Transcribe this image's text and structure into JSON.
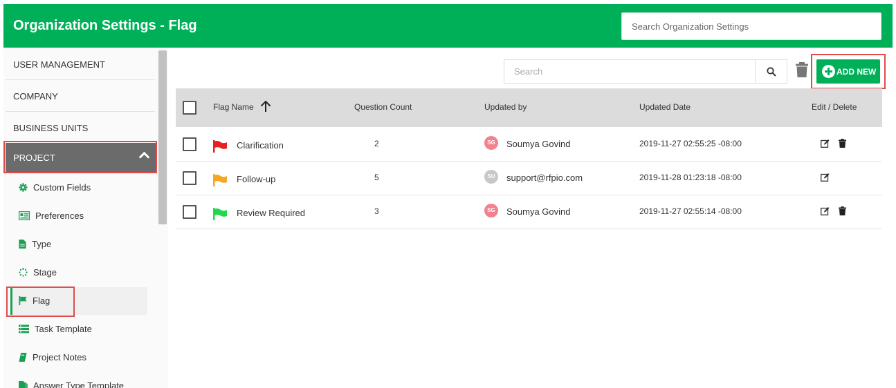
{
  "header": {
    "title": "Organization Settings - Flag",
    "search_placeholder": "Search Organization Settings",
    "bg_color": "#00b058"
  },
  "sidebar": {
    "top_items": [
      {
        "label": "USER MANAGEMENT"
      },
      {
        "label": "COMPANY"
      },
      {
        "label": "BUSINESS UNITS"
      }
    ],
    "project": {
      "label": "PROJECT"
    },
    "sub_items": [
      {
        "label": "Custom Fields",
        "icon": "gear-icon"
      },
      {
        "label": "Preferences",
        "icon": "card-icon"
      },
      {
        "label": "Type",
        "icon": "document-icon"
      },
      {
        "label": "Stage",
        "icon": "dotted-circle-icon"
      },
      {
        "label": "Flag",
        "icon": "flag-icon",
        "active": true
      },
      {
        "label": "Task Template",
        "icon": "list-icon"
      },
      {
        "label": "Project Notes",
        "icon": "book-icon"
      },
      {
        "label": "Answer Type Template",
        "icon": "document-copy-icon"
      }
    ]
  },
  "toolbar": {
    "search_placeholder": "Search",
    "add_label": "ADD NEW"
  },
  "table": {
    "headers": {
      "flag_name": "Flag Name",
      "question_count": "Question Count",
      "updated_by": "Updated by",
      "updated_date": "Updated Date",
      "edit_delete": "Edit / Delete"
    },
    "rows": [
      {
        "name": "Clarification",
        "flag_color": "#e82020",
        "count": "2",
        "initials": "SG",
        "avatar_color": "#f2828f",
        "user": "Soumya Govind",
        "date": "2019-11-27 02:55:25 -08:00",
        "can_delete": true
      },
      {
        "name": "Follow-up",
        "flag_color": "#f5a623",
        "count": "5",
        "initials": "SU",
        "avatar_color": "#c8c8c8",
        "user": "support@rfpio.com",
        "date": "2019-11-28 01:23:18 -08:00",
        "can_delete": false
      },
      {
        "name": "Review Required",
        "flag_color": "#22d84a",
        "count": "3",
        "initials": "SG",
        "avatar_color": "#f2828f",
        "user": "Soumya Govind",
        "date": "2019-11-27 02:55:14 -08:00",
        "can_delete": true
      }
    ]
  }
}
